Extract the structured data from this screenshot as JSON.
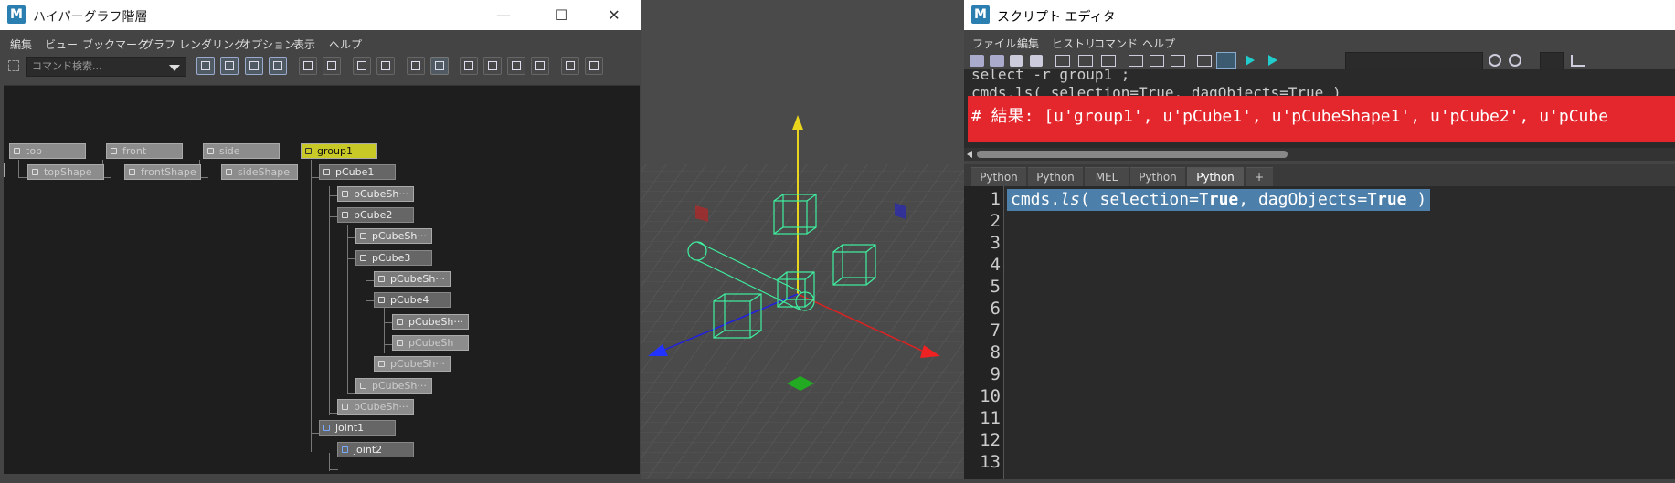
{
  "hypergraph": {
    "title": "ハイパーグラフ階層",
    "menu": [
      "編集",
      "ビュー",
      "ブックマーク",
      "グラフ",
      "レンダリング",
      "オプション",
      "表示",
      "ヘルプ"
    ],
    "search_placeholder": "コマンド検索...",
    "nodes": {
      "top": "top",
      "topShape": "topShape",
      "front": "front",
      "frontShape": "frontShape",
      "side": "side",
      "sideShape": "sideShape",
      "group1": "group1",
      "pCube1": "pCube1",
      "pCubeShape1": "pCubeSh···",
      "pCube2": "pCube2",
      "pCubeShape2": "pCubeSh···",
      "pCube3": "pCube3",
      "pCubeShape3": "pCubeSh···",
      "pCube4": "pCube4",
      "pCubeShape4": "pCubeSh···",
      "pCubeShape4b": "pCubeSh",
      "pCubeShape3b": "pCubeSh···",
      "pCubeShape2b": "pCubeSh···",
      "pCubeShape1b": "pCubeSh···",
      "joint1": "joint1",
      "joint2": "joint2"
    }
  },
  "script_editor": {
    "title": "スクリプト エディタ",
    "menu": [
      "ファイル",
      "編集",
      "ヒストリ",
      "コマンド",
      "ヘルプ"
    ],
    "output_lines": [
      "select -r group1 ;",
      "cmds.ls( selection=True, dagObjects=True )",
      "# 結果: [u'group1', u'pCube1', u'pCubeShape1', u'pCube2', u'pCube"
    ],
    "tabs": [
      "Python",
      "Python",
      "MEL",
      "Python",
      "Python",
      "+"
    ],
    "active_tab": 4,
    "code": {
      "fn": "cmds.",
      "method": "ls",
      "open": "( selection=",
      "true1": "True",
      "mid": ", dagObjects=",
      "true2": "True",
      "close": " )"
    },
    "line_numbers": [
      "1",
      "2",
      "3",
      "4",
      "5",
      "6",
      "7",
      "8",
      "9",
      "10",
      "11",
      "12",
      "13"
    ]
  },
  "colors": {
    "accent_selection": "#c8c826",
    "highlight_red": "#e4272d",
    "code_selection": "#4d7fab",
    "wireframe": "#3ef0a0"
  }
}
